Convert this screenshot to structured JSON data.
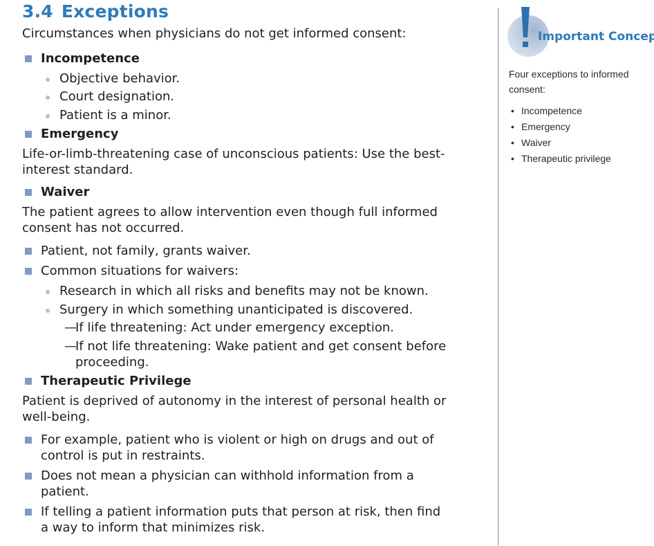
{
  "section": {
    "number": "3.4",
    "title": "Exceptions",
    "intro": "Circumstances when physicians do not get informed consent:"
  },
  "incompetence": {
    "heading": "Incompetence",
    "items": [
      "Objective behavior.",
      "Court designation.",
      "Patient is a minor."
    ]
  },
  "emergency": {
    "heading": "Emergency",
    "text_lines": [
      "Life-or-limb-threatening case of unconscious patients: Use the best-",
      "interest standard."
    ]
  },
  "waiver": {
    "heading": "Waiver",
    "text_lines": [
      "The patient agrees to allow intervention even though full informed",
      "consent has not occurred."
    ],
    "bullet1": "Patient, not family, grants waiver.",
    "bullet2": "Common situations for waivers:",
    "sub1": "Research in which all risks and benefits may not be known.",
    "sub2": "Surgery in which something unanticipated is discovered.",
    "dash1": "If life threatening: Act under emergency exception.",
    "dash2_lines": [
      "If not life threatening: Wake patient and get consent before",
      "proceeding."
    ]
  },
  "therapeutic": {
    "heading": "Therapeutic Privilege",
    "text_lines": [
      "Patient is deprived of autonomy in the interest of personal health or",
      "well-being."
    ],
    "bullets": [
      {
        "lines": [
          "For example, patient who is violent or high on drugs and out of",
          "control is put in restraints."
        ]
      },
      {
        "lines": [
          "Does not mean a physician can withhold information from a",
          "patient."
        ]
      },
      {
        "lines": [
          "If telling a patient information puts that person at risk, then find",
          "a way to inform that minimizes risk."
        ]
      }
    ]
  },
  "sidebar": {
    "title": "Important Concept",
    "icon": "exclamation-icon",
    "intro": "Four exceptions to informed consent:",
    "items": [
      "Incompetence",
      "Emergency",
      "Waiver",
      "Therapeutic privilege"
    ]
  },
  "colors": {
    "heading": "#2e7bb8",
    "square_bullet": "#7f9bbf",
    "round_bullet": "#a9c3de"
  }
}
